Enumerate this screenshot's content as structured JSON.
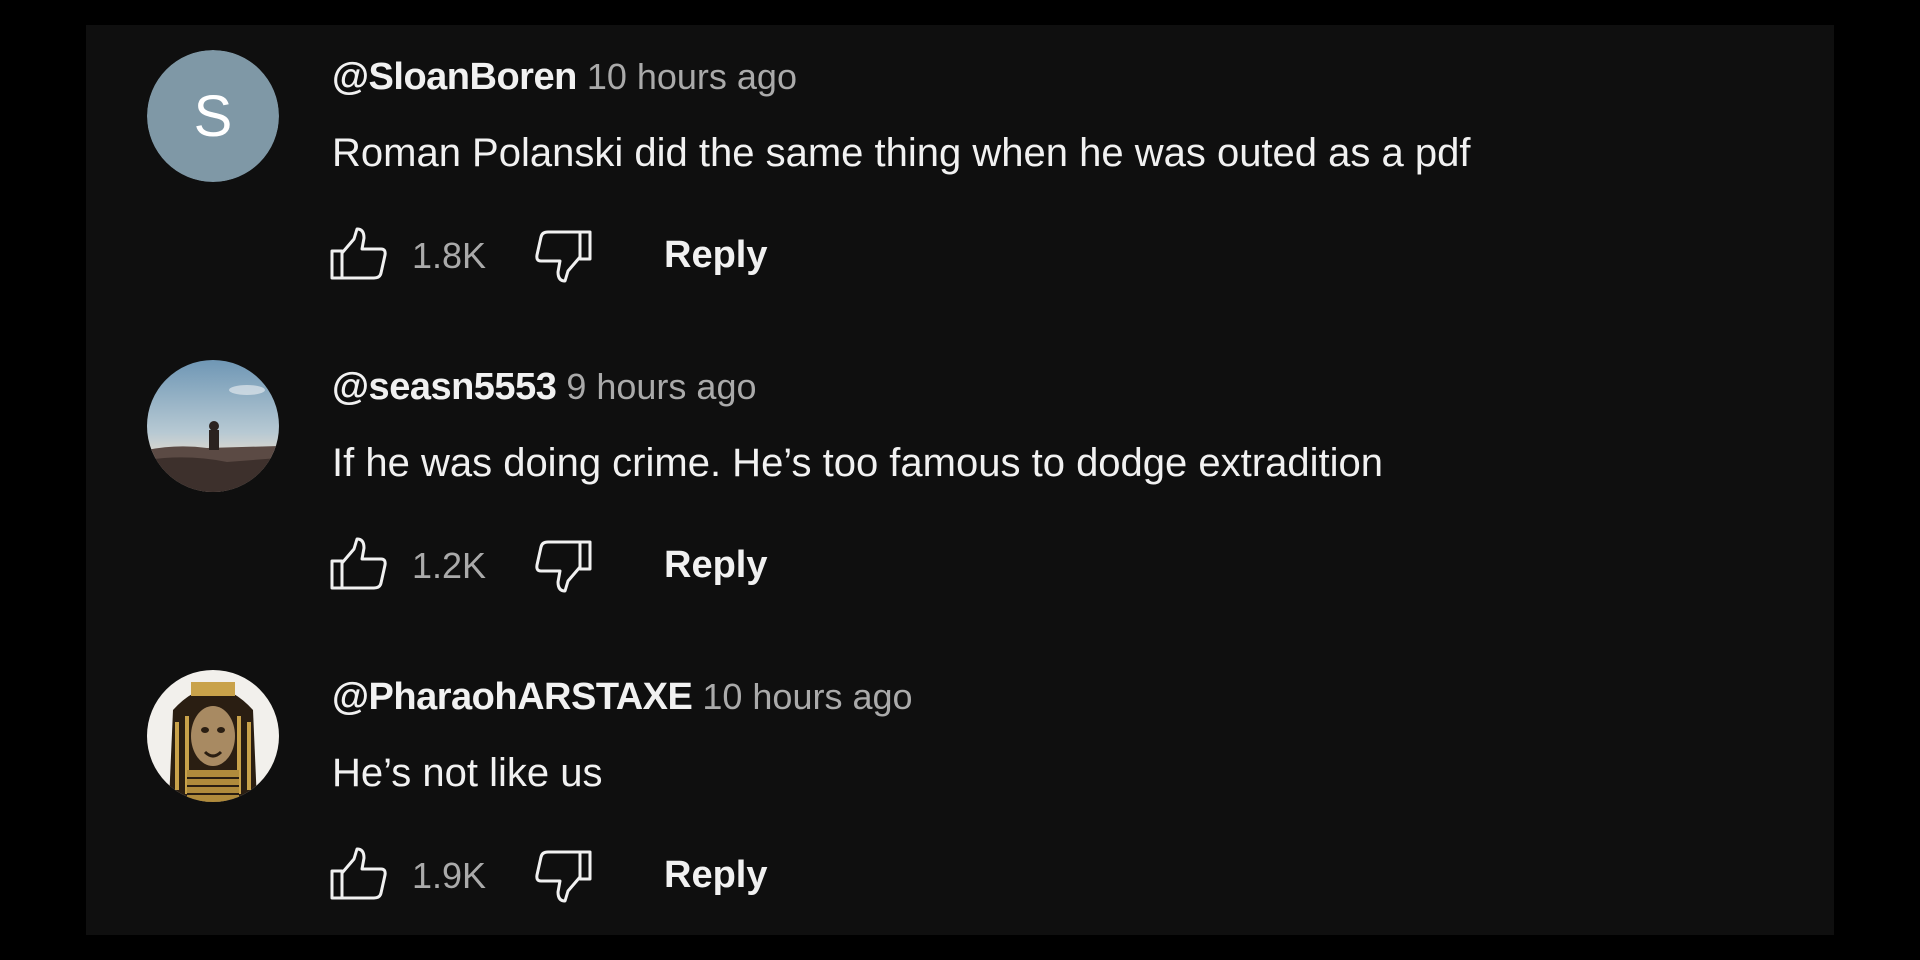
{
  "comments": [
    {
      "author": "@SloanBoren",
      "time": "10 hours ago",
      "text": "Roman Polanski did the same thing when he was outed as a pdf",
      "likes": "1.8K",
      "reply_label": "Reply",
      "avatar": {
        "type": "letter",
        "letter": "S",
        "color": "#7f98a6"
      }
    },
    {
      "author": "@seasn5553",
      "time": "9 hours ago",
      "text": "If he was doing crime. He’s too famous to dodge extradition",
      "likes": "1.2K",
      "reply_label": "Reply",
      "avatar": {
        "type": "photo",
        "subject": "person-on-cliff-sky"
      }
    },
    {
      "author": "@PharaohARSTAXE",
      "time": "10 hours ago",
      "text": "He’s not like us",
      "likes": "1.9K",
      "reply_label": "Reply",
      "avatar": {
        "type": "photo",
        "subject": "lion-pharaoh-headdress"
      }
    }
  ],
  "colors": {
    "background": "#000000",
    "panel": "#0f0f0f",
    "primary_text": "#f1f1f1",
    "secondary_text": "#aaaaaa"
  },
  "icons": [
    "thumbs-up-icon",
    "thumbs-down-icon"
  ]
}
